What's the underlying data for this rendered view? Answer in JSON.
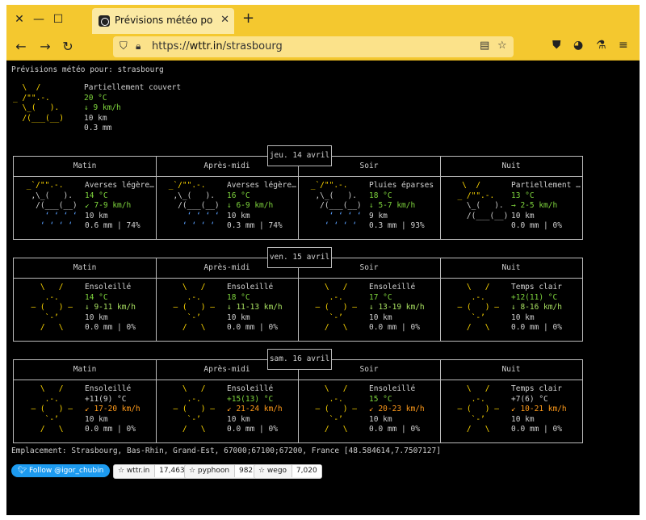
{
  "browser": {
    "tab_title": "Prévisions météo pour: st",
    "url_prefix": "https://",
    "url_host": "wttr.in",
    "url_path": "/strasbourg",
    "controls": {
      "close": "✕",
      "minimize": "—",
      "maximize": "☐",
      "newtab": "+"
    },
    "nav": {
      "back": "←",
      "forward": "→",
      "reload": "↻",
      "menu": "≡"
    }
  },
  "page": {
    "header": "Prévisions météo pour: strasbourg",
    "current": {
      "art": [
        "  \\  /",
        "_ /\"\".-.",
        "  \\_(   ).",
        "  /(___(__)"
      ],
      "lines": [
        {
          "t": "Partiellement couvert",
          "c": "w"
        },
        {
          "t": "20 °C",
          "c": "g"
        },
        {
          "t": "↓ 9 km/h",
          "c": "g"
        },
        {
          "t": "10 km",
          "c": "w"
        },
        {
          "t": "0.3 mm",
          "c": "w"
        }
      ]
    },
    "days": [
      {
        "label": "jeu. 14 avril",
        "periods": [
          "Matin",
          "Après-midi",
          "Soir",
          "Nuit"
        ],
        "cells": [
          {
            "art": [
              " _`/\"\".-.",
              "  ,\\_(   ).",
              "   /(___(__)",
              "     ‘ ‘ ‘ ‘",
              "    ‘ ‘ ‘ ‘"
            ],
            "artc": [
              "y",
              "w",
              "w",
              "b",
              "b"
            ],
            "lines": [
              {
                "t": "Averses légère…",
                "c": "w"
              },
              {
                "t": "14 °C",
                "c": "g"
              },
              {
                "t": "↙ 7-9 km/h",
                "c": "g"
              },
              {
                "t": "10 km",
                "c": "w"
              },
              {
                "t": "0.6 mm | 74%",
                "c": "w"
              }
            ]
          },
          {
            "art": [
              " _`/\"\".-.",
              "  ,\\_(   ).",
              "   /(___(__)",
              "     ‘ ‘ ‘ ‘",
              "    ‘ ‘ ‘ ‘"
            ],
            "artc": [
              "y",
              "w",
              "w",
              "b",
              "b"
            ],
            "lines": [
              {
                "t": "Averses légère…",
                "c": "w"
              },
              {
                "t": "16 °C",
                "c": "g"
              },
              {
                "t": "↓ 6-9 km/h",
                "c": "g"
              },
              {
                "t": "10 km",
                "c": "w"
              },
              {
                "t": "0.3 mm | 74%",
                "c": "w"
              }
            ]
          },
          {
            "art": [
              " _`/\"\".-.",
              "  ,\\_(   ).",
              "   /(___(__)",
              "     ‘ ‘ ‘ ‘",
              "    ‘ ‘ ‘ ‘"
            ],
            "artc": [
              "y",
              "w",
              "w",
              "b",
              "b"
            ],
            "lines": [
              {
                "t": "Pluies éparses",
                "c": "w"
              },
              {
                "t": "18 °C",
                "c": "g"
              },
              {
                "t": "↓ 5-7 km/h",
                "c": "g"
              },
              {
                "t": "9 km",
                "c": "w"
              },
              {
                "t": "0.3 mm | 93%",
                "c": "w"
              }
            ]
          },
          {
            "art": [
              "   \\  /",
              "  _ /\"\".-.",
              "    \\_(   ).",
              "    /(___(__)",
              ""
            ],
            "artc": [
              "y",
              "y",
              "w",
              "w",
              "w"
            ],
            "lines": [
              {
                "t": "Partiellement …",
                "c": "w"
              },
              {
                "t": "13 °C",
                "c": "g"
              },
              {
                "t": "→ 2-5 km/h",
                "c": "g"
              },
              {
                "t": "10 km",
                "c": "w"
              },
              {
                "t": "0.0 mm | 0%",
                "c": "w"
              }
            ]
          }
        ]
      },
      {
        "label": "ven. 15 avril",
        "periods": [
          "Matin",
          "Après-midi",
          "Soir",
          "Nuit"
        ],
        "cells": [
          {
            "art": [
              "    \\   /",
              "     .-.",
              "  ― (   ) ―",
              "     `-’",
              "    /   \\"
            ],
            "artc": [
              "y",
              "y",
              "y",
              "y",
              "y"
            ],
            "lines": [
              {
                "t": "Ensoleillé",
                "c": "w"
              },
              {
                "t": "14 °C",
                "c": "g"
              },
              {
                "t": "↓ 9-11 km/h",
                "c": "lg"
              },
              {
                "t": "10 km",
                "c": "w"
              },
              {
                "t": "0.0 mm | 0%",
                "c": "w"
              }
            ]
          },
          {
            "art": [
              "    \\   /",
              "     .-.",
              "  ― (   ) ―",
              "     `-’",
              "    /   \\"
            ],
            "artc": [
              "y",
              "y",
              "y",
              "y",
              "y"
            ],
            "lines": [
              {
                "t": "Ensoleillé",
                "c": "w"
              },
              {
                "t": "18 °C",
                "c": "g"
              },
              {
                "t": "↓ 11-13 km/h",
                "c": "lg"
              },
              {
                "t": "10 km",
                "c": "w"
              },
              {
                "t": "0.0 mm | 0%",
                "c": "w"
              }
            ]
          },
          {
            "art": [
              "    \\   /",
              "     .-.",
              "  ― (   ) ―",
              "     `-’",
              "    /   \\"
            ],
            "artc": [
              "y",
              "y",
              "y",
              "y",
              "y"
            ],
            "lines": [
              {
                "t": "Ensoleillé",
                "c": "w"
              },
              {
                "t": "17 °C",
                "c": "g"
              },
              {
                "t": "↓ 13-19 km/h",
                "c": "lg"
              },
              {
                "t": "10 km",
                "c": "w"
              },
              {
                "t": "0.0 mm | 0%",
                "c": "w"
              }
            ]
          },
          {
            "art": [
              "    \\   /",
              "     .-.",
              "  ― (   ) ―",
              "     `-’",
              "    /   \\"
            ],
            "artc": [
              "y",
              "y",
              "y",
              "y",
              "y"
            ],
            "lines": [
              {
                "t": "Temps clair",
                "c": "w"
              },
              {
                "t": "+12(11) °C",
                "c": "g"
              },
              {
                "t": "↓ 8-16 km/h",
                "c": "lg"
              },
              {
                "t": "10 km",
                "c": "w"
              },
              {
                "t": "0.0 mm | 0%",
                "c": "w"
              }
            ]
          }
        ]
      },
      {
        "label": "sam. 16 avril",
        "periods": [
          "Matin",
          "Après-midi",
          "Soir",
          "Nuit"
        ],
        "cells": [
          {
            "art": [
              "    \\   /",
              "     .-.",
              "  ― (   ) ―",
              "     `-’",
              "    /   \\"
            ],
            "artc": [
              "y",
              "y",
              "y",
              "y",
              "y"
            ],
            "lines": [
              {
                "t": "Ensoleillé",
                "c": "w"
              },
              {
                "t": "+11(9) °C",
                "c": "w"
              },
              {
                "t": "↙ 17-20 km/h",
                "c": "o"
              },
              {
                "t": "10 km",
                "c": "w"
              },
              {
                "t": "0.0 mm | 0%",
                "c": "w"
              }
            ]
          },
          {
            "art": [
              "    \\   /",
              "     .-.",
              "  ― (   ) ―",
              "     `-’",
              "    /   \\"
            ],
            "artc": [
              "y",
              "y",
              "y",
              "y",
              "y"
            ],
            "lines": [
              {
                "t": "Ensoleillé",
                "c": "w"
              },
              {
                "t": "+15(13) °C",
                "c": "g"
              },
              {
                "t": "↙ 21-24 km/h",
                "c": "o"
              },
              {
                "t": "10 km",
                "c": "w"
              },
              {
                "t": "0.0 mm | 0%",
                "c": "w"
              }
            ]
          },
          {
            "art": [
              "    \\   /",
              "     .-.",
              "  ― (   ) ―",
              "     `-’",
              "    /   \\"
            ],
            "artc": [
              "y",
              "y",
              "y",
              "y",
              "y"
            ],
            "lines": [
              {
                "t": "Ensoleillé",
                "c": "w"
              },
              {
                "t": "15 °C",
                "c": "g"
              },
              {
                "t": "↙ 20-23 km/h",
                "c": "o"
              },
              {
                "t": "10 km",
                "c": "w"
              },
              {
                "t": "0.0 mm | 0%",
                "c": "w"
              }
            ]
          },
          {
            "art": [
              "    \\   /",
              "     .-.",
              "  ― (   ) ―",
              "     `-’",
              "    /   \\"
            ],
            "artc": [
              "y",
              "y",
              "y",
              "y",
              "y"
            ],
            "lines": [
              {
                "t": "Temps clair",
                "c": "w"
              },
              {
                "t": "+7(6) °C",
                "c": "w"
              },
              {
                "t": "↙ 10-21 km/h",
                "c": "o"
              },
              {
                "t": "10 km",
                "c": "w"
              },
              {
                "t": "0.0 mm | 0%",
                "c": "w"
              }
            ]
          }
        ]
      }
    ],
    "location": "Emplacement: Strasbourg, Bas-Rhin, Grand-Est, 67000;67100;67200, France [48.584614,7.7507127]",
    "buttons": {
      "twitter": "Follow @igor_chubin",
      "repos": [
        {
          "name": "wttr.in",
          "count": "17,463"
        },
        {
          "name": "pyphoon",
          "count": "982"
        },
        {
          "name": "wego",
          "count": "7,020"
        }
      ]
    }
  }
}
